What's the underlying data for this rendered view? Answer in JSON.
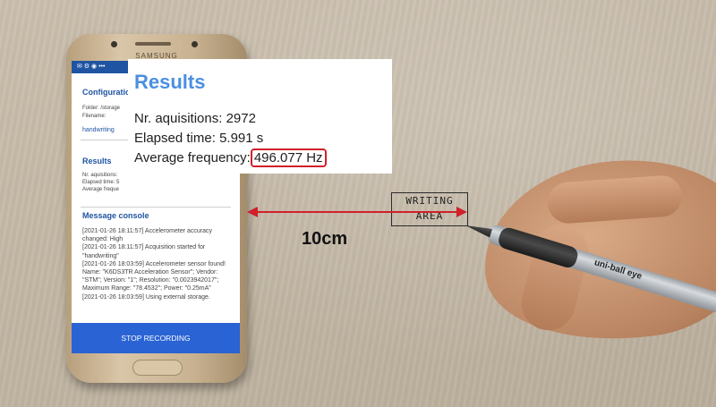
{
  "phone": {
    "brand": "SAMSUNG",
    "status": "✉ ⚙ ◉ •••",
    "config_title": "Configuration",
    "folder_label": "Folder: /storage",
    "filename_label": "Filename:",
    "filename_value": "handwriting",
    "results_title": "Results",
    "results_line1": "Nr. aquisitions:",
    "results_line2": "Elapsed time: 5",
    "results_line3": "Average freque",
    "console_title": "Message console",
    "console_text": "[2021-01-26 18:11:57] Accelerometer accuracy changed: High\n[2021-01-26 18:11:57] Acquisition started for \"handwriting\"\n[2021-01-26 18:03:59] Accelerometer sensor found! Name: \"K6DS3TR Acceleration Sensor\"; Vendor: \"STM\"; Version: \"1\"; Resolution: \"0.0023942017\"; Maximum Range: \"78.4532\"; Power: \"0.25mA\"\n[2021-01-26 18:03:59] Using external storage.",
    "stop_button": "STOP RECORDING"
  },
  "results_overlay": {
    "title": "Results",
    "acquisitions_label": "Nr. aquisitions:",
    "acquisitions_value": "2972",
    "elapsed_label": "Elapsed time:",
    "elapsed_value": "5.991 s",
    "frequency_label": "Average frequency:",
    "frequency_value": "496.077 Hz",
    "highlight_color": "#d0202a"
  },
  "annotation": {
    "distance_label": "10cm",
    "arrow_color": "#d0202a"
  },
  "writing_area": {
    "line1": "WRITING",
    "line2": "AREA"
  },
  "pen": {
    "brand": "uni-ball  eye"
  }
}
